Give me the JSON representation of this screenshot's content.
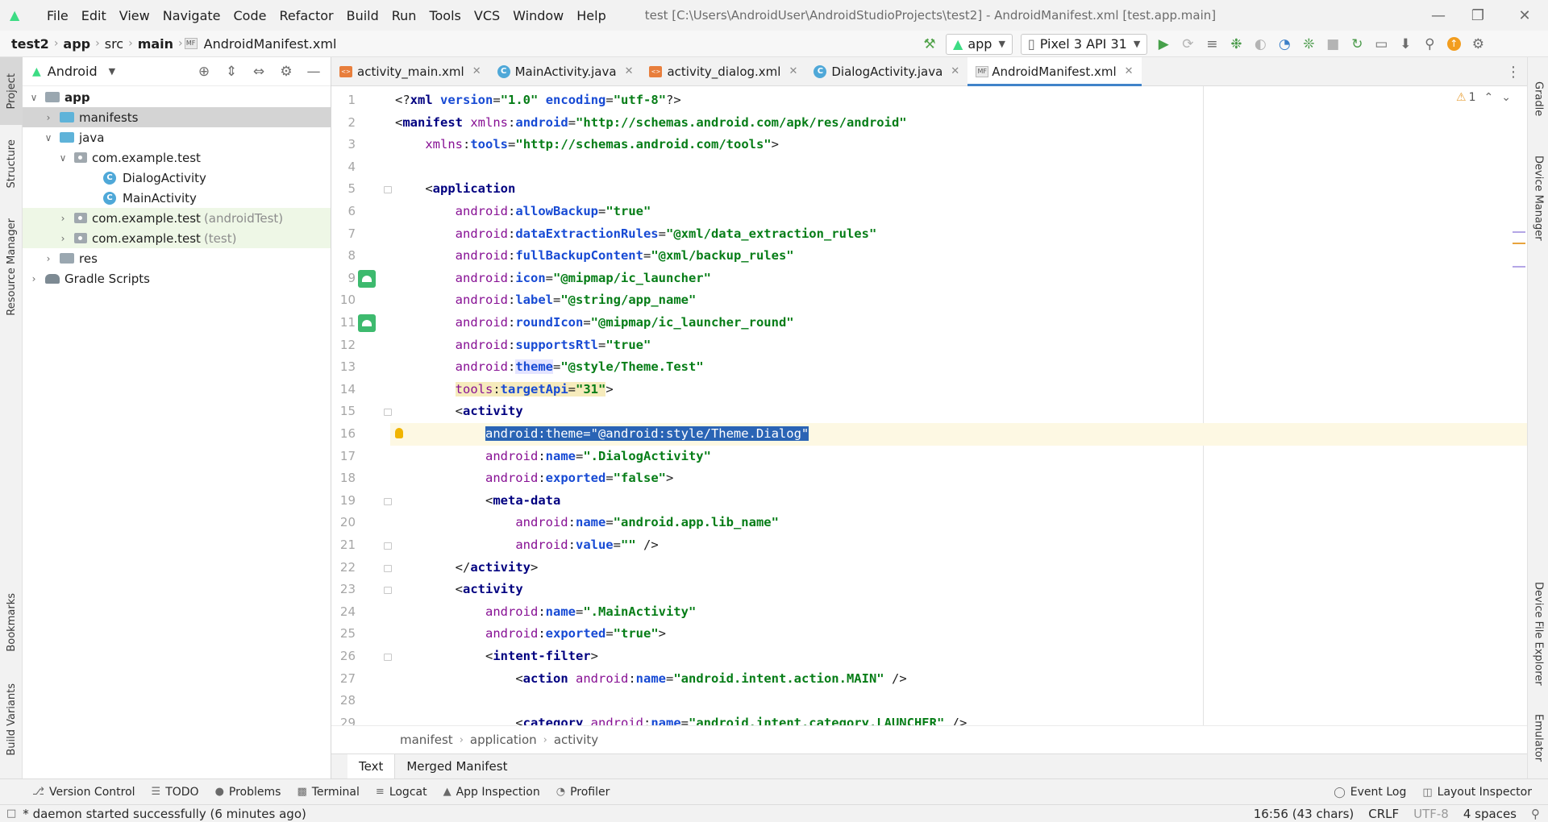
{
  "window": {
    "menu": [
      "File",
      "Edit",
      "View",
      "Navigate",
      "Code",
      "Refactor",
      "Build",
      "Run",
      "Tools",
      "VCS",
      "Window",
      "Help"
    ],
    "title": "test [C:\\Users\\AndroidUser\\AndroidStudioProjects\\test2] - AndroidManifest.xml [test.app.main]"
  },
  "nav": {
    "breadcrumb": [
      "test2",
      "app",
      "src",
      "main",
      "AndroidManifest.xml"
    ],
    "run_config": "app",
    "device": "Pixel 3 API 31"
  },
  "left_stripe": [
    "Project",
    "Structure",
    "Resource Manager",
    "Bookmarks",
    "Build Variants"
  ],
  "right_stripe": [
    "Gradle",
    "Device Manager",
    "Device File Explorer",
    "Emulator"
  ],
  "project": {
    "view": "Android",
    "tree": [
      {
        "label": "app",
        "suffix": ""
      },
      {
        "label": "manifests",
        "suffix": ""
      },
      {
        "label": "java",
        "suffix": ""
      },
      {
        "label": "com.example.test",
        "suffix": ""
      },
      {
        "label": "DialogActivity",
        "suffix": ""
      },
      {
        "label": "MainActivity",
        "suffix": ""
      },
      {
        "label": "com.example.test",
        "suffix": "(androidTest)"
      },
      {
        "label": "com.example.test",
        "suffix": "(test)"
      },
      {
        "label": "res",
        "suffix": ""
      },
      {
        "label": "Gradle Scripts",
        "suffix": ""
      }
    ]
  },
  "tabs": [
    {
      "label": "activity_main.xml",
      "kind": "xml"
    },
    {
      "label": "MainActivity.java",
      "kind": "java"
    },
    {
      "label": "activity_dialog.xml",
      "kind": "xml"
    },
    {
      "label": "DialogActivity.java",
      "kind": "java"
    },
    {
      "label": "AndroidManifest.xml",
      "kind": "manifest"
    }
  ],
  "editor": {
    "warning_count": "1",
    "line_numbers": [
      "1",
      "2",
      "3",
      "4",
      "5",
      "6",
      "7",
      "8",
      "9",
      "10",
      "11",
      "12",
      "13",
      "14",
      "15",
      "16",
      "17",
      "18",
      "19",
      "20",
      "21",
      "22",
      "23",
      "24",
      "25",
      "26",
      "27",
      "28",
      "29"
    ],
    "lines": [
      "<?xml version=\"1.0\" encoding=\"utf-8\"?>",
      "<manifest xmlns:android=\"http://schemas.android.com/apk/res/android\"",
      "    xmlns:tools=\"http://schemas.android.com/tools\">",
      "",
      "    <application",
      "        android:allowBackup=\"true\"",
      "        android:dataExtractionRules=\"@xml/data_extraction_rules\"",
      "        android:fullBackupContent=\"@xml/backup_rules\"",
      "        android:icon=\"@mipmap/ic_launcher\"",
      "        android:label=\"@string/app_name\"",
      "        android:roundIcon=\"@mipmap/ic_launcher_round\"",
      "        android:supportsRtl=\"true\"",
      "        android:theme=\"@style/Theme.Test\"",
      "        tools:targetApi=\"31\">",
      "        <activity",
      "            android:theme=\"@android:style/Theme.Dialog\"",
      "            android:name=\".DialogActivity\"",
      "            android:exported=\"false\">",
      "            <meta-data",
      "                android:name=\"android.app.lib_name\"",
      "                android:value=\"\" />",
      "        </activity>",
      "        <activity",
      "            android:name=\".MainActivity\"",
      "            android:exported=\"true\">",
      "            <intent-filter>",
      "                <action android:name=\"android.intent.action.MAIN\" />",
      "",
      "                <category android:name=\"android.intent.category.LAUNCHER\" />"
    ]
  },
  "path_crumbs": [
    "manifest",
    "application",
    "activity"
  ],
  "mode_tabs": [
    "Text",
    "Merged Manifest"
  ],
  "tool_windows": [
    "Version Control",
    "TODO",
    "Problems",
    "Terminal",
    "Logcat",
    "App Inspection",
    "Profiler"
  ],
  "tool_windows_right": [
    "Event Log",
    "Layout Inspector"
  ],
  "status": {
    "message": "* daemon started successfully (6 minutes ago)",
    "position": "16:56 (43 chars)",
    "line_sep": "CRLF",
    "encoding": "UTF-8",
    "indent": "4 spaces"
  },
  "colors": {
    "accent": "#4083c9",
    "android_green": "#3ddc84",
    "selection": "#2a64b5"
  }
}
